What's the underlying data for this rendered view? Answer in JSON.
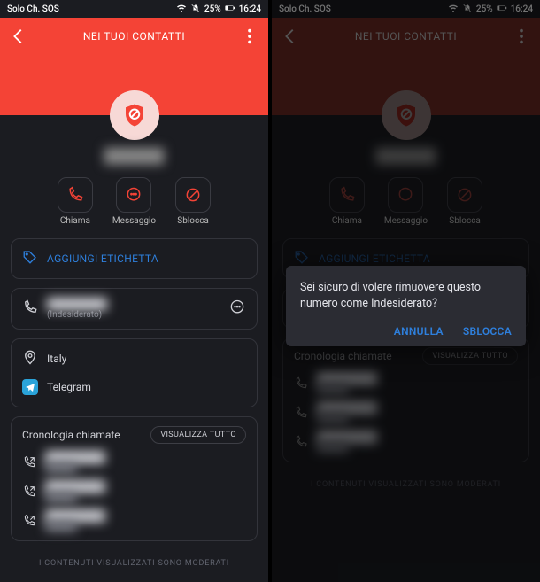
{
  "status": {
    "carrier": "Solo Ch. SOS",
    "battery_text": "25%",
    "time": "16:24"
  },
  "header": {
    "title": "NEI TUOI CONTATTI"
  },
  "contact": {
    "name": "██████"
  },
  "actions": {
    "call": "Chiama",
    "message": "Messaggio",
    "unblock": "Sblocca"
  },
  "add_label": "AGGIUNGI ETICHETTA",
  "phone_entry": {
    "number": "████████",
    "tag": "(Indesiderato)"
  },
  "info": {
    "country": "Italy",
    "telegram": "Telegram"
  },
  "history": {
    "title": "Cronologia chiamate",
    "view_all": "VISUALIZZA TUTTO",
    "rows": [
      {
        "number": "████████",
        "when": "█████"
      },
      {
        "number": "████████",
        "when": "█████"
      },
      {
        "number": "████████",
        "when": "█████"
      }
    ]
  },
  "footer": "I CONTENUTI VISUALIZZATI SONO MODERATI",
  "dialog": {
    "message": "Sei sicuro di volere rimuovere questo numero come Indesiderato?",
    "cancel": "ANNULLA",
    "confirm": "SBLOCCA"
  },
  "colors": {
    "accent": "#f44336",
    "link": "#2e7fdc"
  }
}
